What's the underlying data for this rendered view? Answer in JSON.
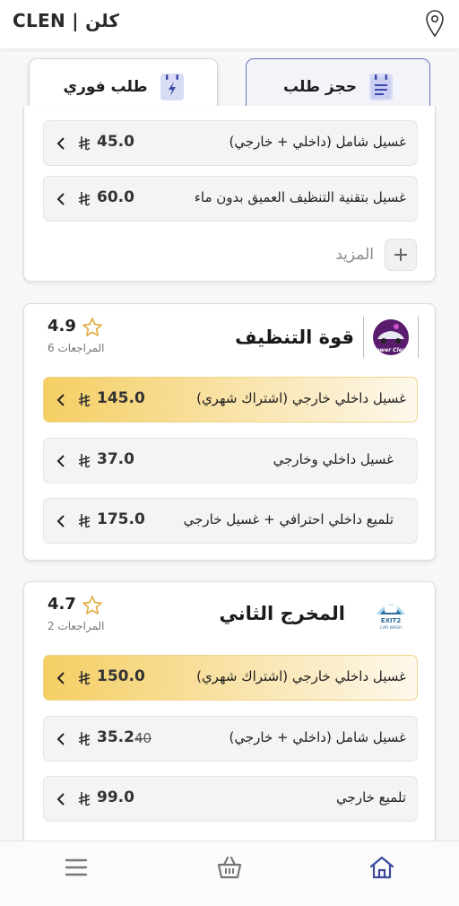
{
  "app": {
    "brand": "CLEN | كلن",
    "location_icon": "map-pin-icon"
  },
  "tabs": [
    {
      "label": "حجز طلب",
      "icon": "calendar-icon",
      "active": true
    },
    {
      "label": "طلب فوري",
      "icon": "lightning-icon",
      "active": false
    }
  ],
  "currency_icon": "riyal-icon",
  "card1": {
    "services": [
      {
        "name": "غسيل شامل (داخلي + خارجي)",
        "price": "45.0",
        "highlighted": false
      },
      {
        "name": "غسيل بتقنية التنظيف العميق بدون ماء",
        "price": "60.0",
        "highlighted": false
      }
    ],
    "more_label": "المزيد",
    "more_icon": "plus-icon"
  },
  "card2": {
    "provider_name": "قوة التنظيف",
    "logo_text": "Power Clean",
    "rating": "4.9",
    "reviews": "المراجعات 6",
    "services": [
      {
        "name": "غسيل داخلي خارجي (اشتراك شهري)",
        "price": "145.0",
        "highlighted": true
      },
      {
        "name": "غسيل داخلي وخارجي",
        "price": "37.0",
        "highlighted": false
      },
      {
        "name": "تلميع داخلي احترافي + غسيل خارجي",
        "price": "175.0",
        "highlighted": false
      }
    ]
  },
  "card3": {
    "provider_name": "المخرج الثاني",
    "logo_text": "EXIT2 CAR WASH",
    "rating": "4.7",
    "reviews": "المراجعات 2",
    "services": [
      {
        "name": "غسيل داخلي خارجي (اشتراك شهري)",
        "price": "150.0",
        "highlighted": true
      },
      {
        "name": "غسيل شامل (داخلي + خارجي)",
        "price": "35.2",
        "old_price": "40",
        "highlighted": false
      },
      {
        "name": "تلميع خارجي",
        "price": "99.0",
        "highlighted": false
      }
    ]
  },
  "bottom_nav": [
    {
      "name": "menu",
      "icon": "menu-icon"
    },
    {
      "name": "basket",
      "icon": "basket-icon"
    },
    {
      "name": "home",
      "icon": "home-icon",
      "color": "#3b4a9c"
    }
  ],
  "colors": {
    "accent": "#6b74b8",
    "highlight": "#f5cf63",
    "home_active": "#3b4a9c"
  }
}
